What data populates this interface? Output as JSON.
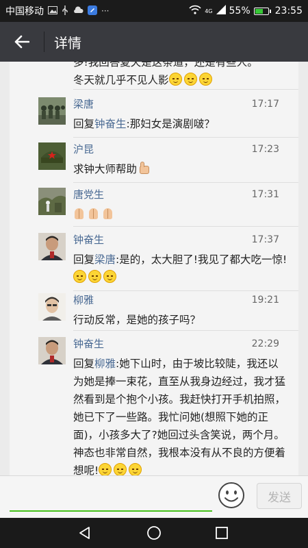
{
  "status_bar": {
    "carrier": "中国移动",
    "network": "4G",
    "battery": "55%",
    "battery_level": 0.55,
    "time": "23:55",
    "icons": [
      "image-icon",
      "usb-icon",
      "cloud-icon",
      "app-icon",
      "more-icon",
      "wifi-icon",
      "signal-icon",
      "battery-icon"
    ]
  },
  "header": {
    "title": "详情",
    "back_icon": "back-arrow-icon"
  },
  "partial_comment": {
    "line1": "多!我回答夏天是这条道，还是有些人。",
    "line2": "冬天就几乎不见人影"
  },
  "comments": [
    {
      "name": "梁唐",
      "time": "17:17",
      "prefix": "回复",
      "mention": "钟奋生",
      "text": ":那妇女是演剧啵？"
    },
    {
      "name": "沪昆",
      "time": "17:23",
      "text": "求钟大师帮助"
    },
    {
      "name": "唐党生",
      "time": "17:31"
    },
    {
      "name": "钟奋生",
      "time": "17:37",
      "prefix": "回复",
      "mention": "梁唐",
      "text": ":是的，太大胆了!我见了都大吃一惊!"
    },
    {
      "name": "柳雅",
      "time": "19:21",
      "text": "行动反常，是她的孩子吗？"
    },
    {
      "name": "钟奋生",
      "time": "22:29",
      "prefix": "回复",
      "mention": "柳雅",
      "text": ":她下山时，由于坡比较陡，我还以为她是捧一束花，直至从我身边经过，我才猛然看到是个抱个小孩。我赶快打开手机拍照，她已下了一些路。我忙问她(想照下她的正面)，小孩多大了?她回过头含笑说，两个月。神态也非常自然，我根本没有从不良的方便着想呢!"
    }
  ],
  "input_bar": {
    "placeholder": "",
    "send_label": "发送",
    "emoji_icon": "emoji-face-icon"
  },
  "nav_bar": {
    "icons": [
      "nav-back-icon",
      "nav-home-icon",
      "nav-recents-icon"
    ]
  },
  "colors": {
    "header_bg": "#393a3f",
    "name_color": "#4a6a93",
    "accent_green": "#45c01a"
  }
}
